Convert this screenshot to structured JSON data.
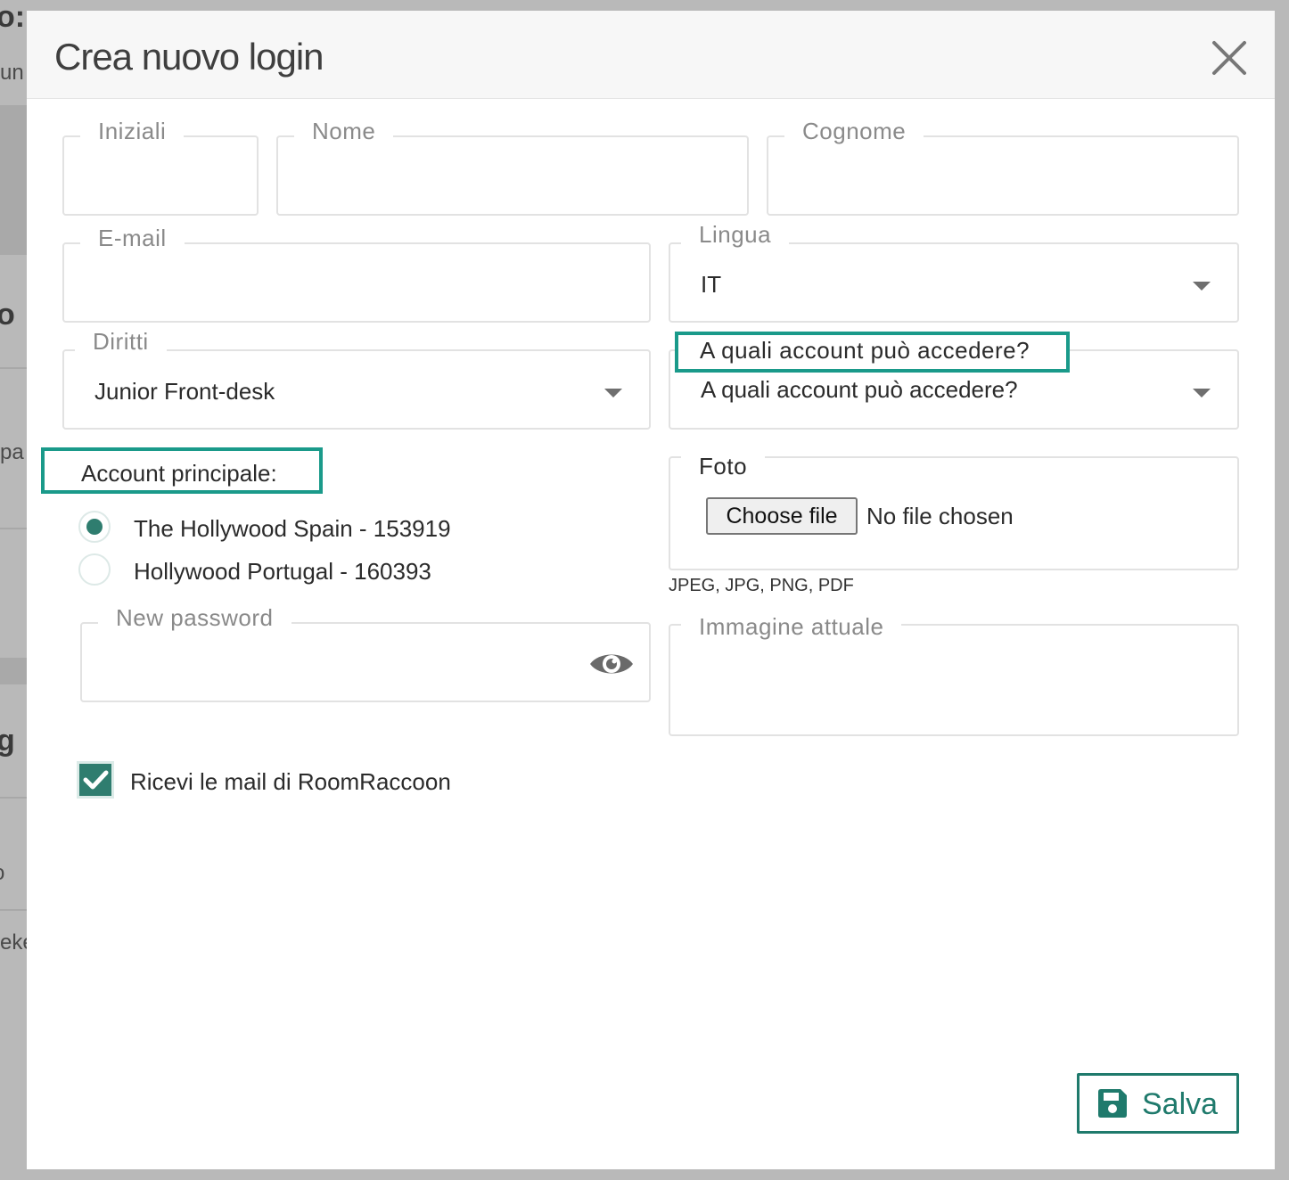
{
  "background": {
    "fragment_1": "o:",
    "fragment_2": "un",
    "fragment_3": "o",
    "fragment_4": "pa",
    "fragment_5": "g",
    "fragment_6": "o",
    "fragment_7": "eke"
  },
  "modal": {
    "title": "Crea nuovo login",
    "close_icon": "close-icon"
  },
  "form": {
    "initials": {
      "label": "Iniziali",
      "value": ""
    },
    "first_name": {
      "label": "Nome",
      "value": ""
    },
    "last_name": {
      "label": "Cognome",
      "value": ""
    },
    "email": {
      "label": "E-mail",
      "value": ""
    },
    "language": {
      "label": "Lingua",
      "value": "IT"
    },
    "rights": {
      "label": "Diritti",
      "value": "Junior Front-desk"
    },
    "accounts_access": {
      "label": "A quali account può accedere?",
      "value": "A quali account può accedere?"
    },
    "main_account": {
      "label": "Account principale:",
      "options": [
        {
          "label": "The Hollywood Spain - 153919",
          "checked": true
        },
        {
          "label": "Hollywood Portugal - 160393",
          "checked": false
        }
      ]
    },
    "photo": {
      "label": "Foto",
      "button_label": "Choose file",
      "status": "No file chosen",
      "accepted_types": "JPEG, JPG, PNG, PDF"
    },
    "new_password": {
      "label": "New password",
      "value": "",
      "toggle_icon": "eye-icon"
    },
    "current_image": {
      "label": "Immagine attuale"
    },
    "receive_emails": {
      "label": "Ricevi le mail di RoomRaccoon",
      "checked": true
    }
  },
  "footer": {
    "save_label": "Salva",
    "save_icon": "floppy-disk-icon"
  },
  "colors": {
    "accent": "#2f7d6f",
    "highlight": "#1a9a8a",
    "border": "#e2e2e2",
    "label": "#8a8a8a"
  }
}
